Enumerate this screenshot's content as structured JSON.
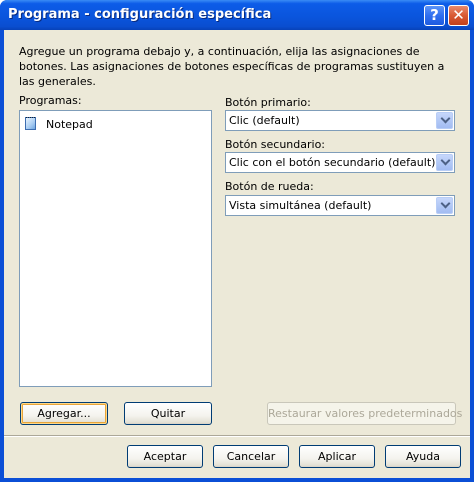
{
  "window": {
    "title": "Programa - configuración específica",
    "help_icon": "question-mark-icon",
    "close_icon": "close-x-icon"
  },
  "intro": {
    "text": "Agregue un programa debajo y, a continuación, elija las asignaciones de botones. Las asignaciones de botones específicas de programas sustituyen a las generales."
  },
  "programs": {
    "label": "Programas:",
    "items": [
      {
        "label": "Notepad",
        "icon": "notepad-icon"
      }
    ]
  },
  "primary": {
    "label": "Botón primario:",
    "selected": "Clic (default)"
  },
  "secondary": {
    "label": "Botón secundario:",
    "selected": "Clic con el botón secundario (default)"
  },
  "wheel": {
    "label": "Botón de rueda:",
    "selected": "Vista simultánea (default)"
  },
  "buttons": {
    "add": "Agregar...",
    "remove": "Quitar",
    "restore": "Restaurar valores predeterminados",
    "ok": "Aceptar",
    "cancel": "Cancelar",
    "apply": "Aplicar",
    "help": "Ayuda"
  }
}
